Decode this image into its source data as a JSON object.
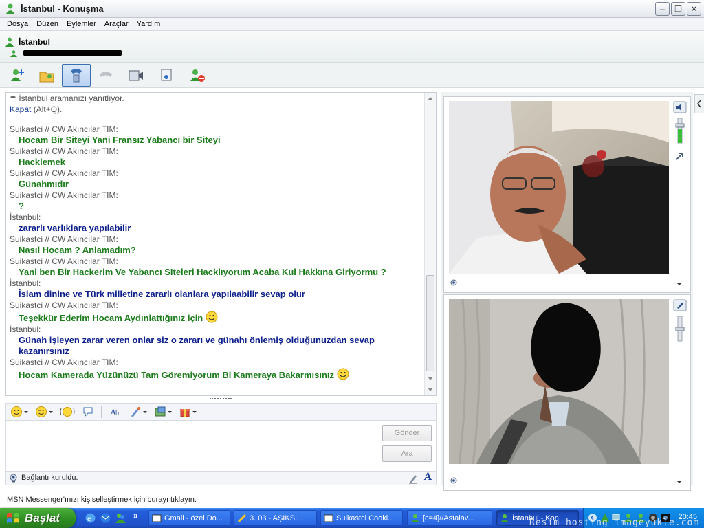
{
  "window": {
    "title": "İstanbul - Konuşma"
  },
  "menu": {
    "items": [
      "Dosya",
      "Düzen",
      "Eylemler",
      "Araçlar",
      "Yardım"
    ]
  },
  "contact": {
    "name": "İstanbul"
  },
  "toolbar": {
    "icons": [
      "invite-icon",
      "send-files-icon",
      "call-icon",
      "hang-up-icon",
      "video-icon",
      "activities-icon",
      "block-icon"
    ]
  },
  "conversation": {
    "system_line": "İstanbul aramanızı yanıtlıyor.",
    "hangup_link": "Kapat",
    "hangup_shortcut": "(Alt+Q).",
    "messages": [
      {
        "sender": "Suikastci // CW Akıncılar TIM:",
        "text": "Hocam Bir Siteyi Yani Fransız Yabancı bir Siteyi",
        "color": "green",
        "smiley": false
      },
      {
        "sender": "Suikastci // CW Akıncılar TIM:",
        "text": "Hacklemek",
        "color": "green",
        "smiley": false
      },
      {
        "sender": "Suikastci // CW Akıncılar TIM:",
        "text": "Günahmıdır",
        "color": "green",
        "smiley": false
      },
      {
        "sender": "Suikastci // CW Akıncılar TIM:",
        "text": "?",
        "color": "green",
        "smiley": false
      },
      {
        "sender": "İstanbul:",
        "text": "zararlı varlıklara yapılabilir",
        "color": "blue",
        "smiley": false
      },
      {
        "sender": "Suikastci // CW Akıncılar TIM:",
        "text": "Nasıl Hocam ? Anlamadım?",
        "color": "green",
        "smiley": false
      },
      {
        "sender": "Suikastci // CW Akıncılar TIM:",
        "text": "Yani ben Bir Hackerim Ve Yabancı SIteleri Hacklıyorum Acaba Kul Hakkına Giriyormu ?",
        "color": "green",
        "smiley": false
      },
      {
        "sender": "İstanbul:",
        "text": "İslam dinine ve Türk milletine zararlı olanlara yapılaabilir sevap olur",
        "color": "blue",
        "smiley": false
      },
      {
        "sender": "Suikastci // CW Akıncılar TIM:",
        "text": "Teşekkür Ederim Hocam Aydınlattığınız İçin",
        "color": "green",
        "smiley": true
      },
      {
        "sender": "İstanbul:",
        "text": "Günah işleyen zarar veren onlar siz o zararı ve günahı önlemiş olduğunuzdan sevap kazanırsınız",
        "color": "blue",
        "smiley": false
      },
      {
        "sender": "Suikastci // CW Akıncılar TIM:",
        "text": "Hocam Kamerada Yüzünüzü Tam Göremiyorum Bi Kameraya Bakarmısınız",
        "color": "green",
        "smiley": true
      }
    ]
  },
  "input": {
    "send_label": "Gönder",
    "search_label": "Ara",
    "status": "Bağlantı kuruldu.",
    "font_glyph": "A"
  },
  "customize_text": "MSN Messenger'ınızı kişiselleştirmek için burayı tıklayın.",
  "taskbar": {
    "start_label": "Başlat",
    "tasks": [
      "Gmail - özel Do...",
      "3. 03 - AŞIKSI...",
      "Suikastci Cooki...",
      "[c=4]//Astalav...",
      "İstanbul - Kon..."
    ],
    "clock": "20:45"
  },
  "watermark": "Resim hosting imageyukle.com",
  "colors": {
    "green_text": "#1c7c1c",
    "blue_text": "#0c1f8c",
    "taskbar": "#245edb",
    "start": "#2d8c22"
  }
}
